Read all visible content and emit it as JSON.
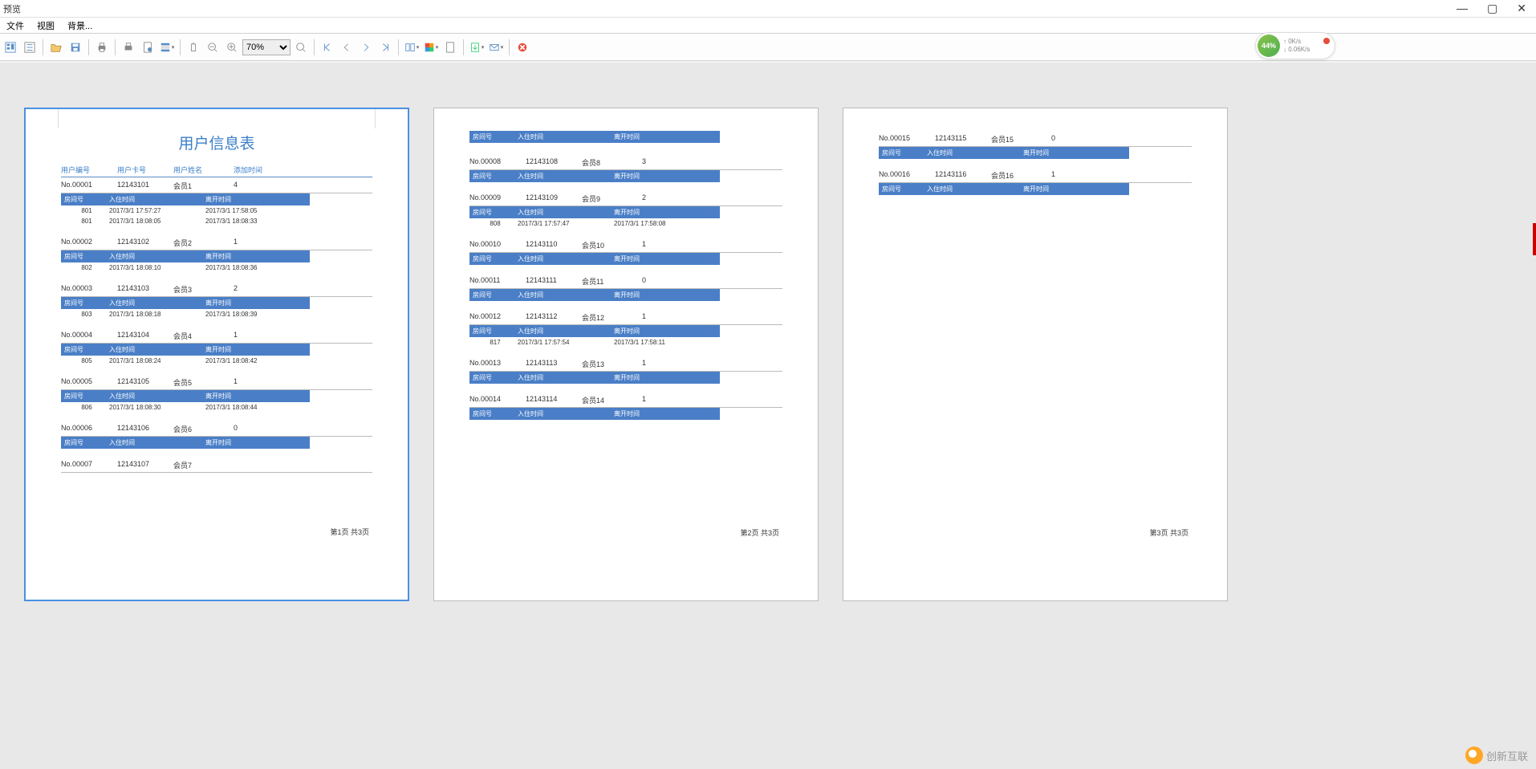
{
  "window": {
    "title": "预览"
  },
  "menus": {
    "file": "文件",
    "view": "视图",
    "background": "背景..."
  },
  "toolbar": {
    "zoom": "70%"
  },
  "netwidget": {
    "pct": "44%",
    "up": "↑ 0K/s",
    "down": "↓ 0.06K/s"
  },
  "watermark": "创新互联",
  "report": {
    "title": "用户信息表",
    "columns": {
      "c1": "用户编号",
      "c2": "用户卡号",
      "c3": "用户姓名",
      "c4": "添加时间"
    },
    "sub_columns": {
      "s1": "房间号",
      "s2": "入住时间",
      "s3": "离开时间"
    },
    "footer": {
      "p1": "第1页  共3页",
      "p2": "第2页  共3页",
      "p3": "第3页  共3页"
    }
  },
  "users_p1": [
    {
      "uid": "No.00001",
      "card": "12143101",
      "name": "会员1",
      "cnt": "4",
      "details": [
        {
          "room": "801",
          "in": "2017/3/1 17:57:27",
          "out": "2017/3/1 17:58:05"
        },
        {
          "room": "801",
          "in": "2017/3/1 18:08:05",
          "out": "2017/3/1 18:08:33"
        }
      ]
    },
    {
      "uid": "No.00002",
      "card": "12143102",
      "name": "会员2",
      "cnt": "1",
      "details": [
        {
          "room": "802",
          "in": "2017/3/1 18:08:10",
          "out": "2017/3/1 18:08:36"
        }
      ]
    },
    {
      "uid": "No.00003",
      "card": "12143103",
      "name": "会员3",
      "cnt": "2",
      "details": [
        {
          "room": "803",
          "in": "2017/3/1 18:08:18",
          "out": "2017/3/1 18:08:39"
        }
      ]
    },
    {
      "uid": "No.00004",
      "card": "12143104",
      "name": "会员4",
      "cnt": "1",
      "details": [
        {
          "room": "805",
          "in": "2017/3/1 18:08:24",
          "out": "2017/3/1 18:08:42"
        }
      ]
    },
    {
      "uid": "No.00005",
      "card": "12143105",
      "name": "会员5",
      "cnt": "1",
      "details": [
        {
          "room": "806",
          "in": "2017/3/1 18:08:30",
          "out": "2017/3/1 18:08:44"
        }
      ]
    },
    {
      "uid": "No.00006",
      "card": "12143106",
      "name": "会员6",
      "cnt": "0",
      "details": []
    },
    {
      "uid": "No.00007",
      "card": "12143107",
      "name": "会员7",
      "cnt": "",
      "details": null
    }
  ],
  "users_p2": [
    {
      "uid": "No.00008",
      "card": "12143108",
      "name": "会员8",
      "cnt": "3",
      "details": [],
      "header_before": true
    },
    {
      "uid": "No.00009",
      "card": "12143109",
      "name": "会员9",
      "cnt": "2",
      "details": [
        {
          "room": "808",
          "in": "2017/3/1 17:57:47",
          "out": "2017/3/1 17:58:08"
        }
      ]
    },
    {
      "uid": "No.00010",
      "card": "12143110",
      "name": "会员10",
      "cnt": "1",
      "details": []
    },
    {
      "uid": "No.00011",
      "card": "12143111",
      "name": "会员11",
      "cnt": "0",
      "details": []
    },
    {
      "uid": "No.00012",
      "card": "12143112",
      "name": "会员12",
      "cnt": "1",
      "details": [
        {
          "room": "817",
          "in": "2017/3/1 17:57:54",
          "out": "2017/3/1 17:58:11"
        }
      ]
    },
    {
      "uid": "No.00013",
      "card": "12143113",
      "name": "会员13",
      "cnt": "1",
      "details": []
    },
    {
      "uid": "No.00014",
      "card": "12143114",
      "name": "会员14",
      "cnt": "1",
      "details": []
    }
  ],
  "users_p3": [
    {
      "uid": "No.00015",
      "card": "12143115",
      "name": "会员15",
      "cnt": "0",
      "details": []
    },
    {
      "uid": "No.00016",
      "card": "12143116",
      "name": "会员16",
      "cnt": "1",
      "details": []
    }
  ]
}
